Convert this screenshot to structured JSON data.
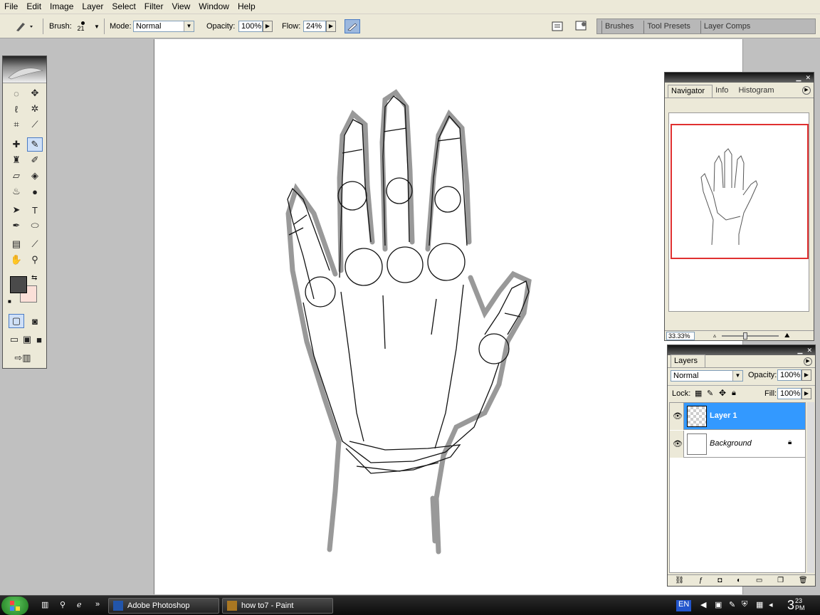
{
  "menu": [
    "File",
    "Edit",
    "Image",
    "Layer",
    "Select",
    "Filter",
    "View",
    "Window",
    "Help"
  ],
  "options_bar": {
    "brush_label": "Brush:",
    "brush_size": "21",
    "mode_label": "Mode:",
    "mode_value": "Normal",
    "opacity_label": "Opacity:",
    "opacity_value": "100%",
    "flow_label": "Flow:",
    "flow_value": "24%",
    "palette_tabs": [
      "Brushes",
      "Tool Presets",
      "Layer Comps"
    ]
  },
  "navigator": {
    "tabs": [
      "Navigator",
      "Info",
      "Histogram"
    ],
    "zoom": "33.33%",
    "view_box_color": "#e03030"
  },
  "layers": {
    "title": "Layers",
    "blend_mode": "Normal",
    "opacity_label": "Opacity:",
    "opacity_value": "100%",
    "lock_label": "Lock:",
    "fill_label": "Fill:",
    "fill_value": "100%",
    "items": [
      {
        "name": "Layer 1",
        "selected": true
      },
      {
        "name": "Background",
        "selected": false
      }
    ]
  },
  "taskbar": {
    "tasks": [
      "Adobe Photoshop",
      "how to7 - Paint"
    ],
    "lang": "EN",
    "time_hour": "3",
    "time_min": "23",
    "time_ampm": "PM"
  },
  "colors": {
    "foreground": "#4a4a4a",
    "background": "#fbe0d8",
    "selection": "#3399ff"
  }
}
